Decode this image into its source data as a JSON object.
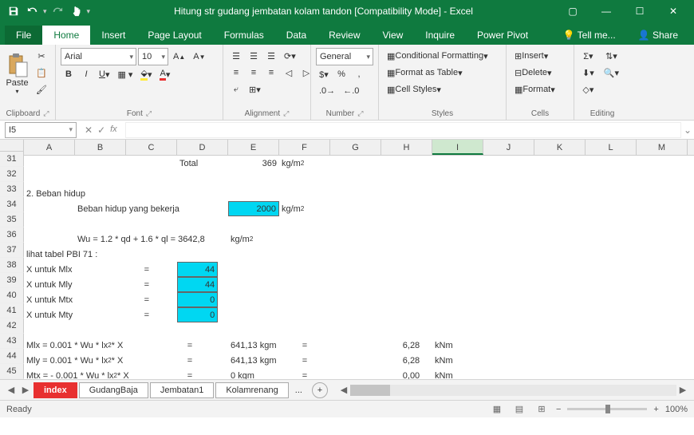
{
  "title": "Hitung str gudang jembatan kolam tandon  [Compatibility Mode] - Excel",
  "tabs": [
    "File",
    "Home",
    "Insert",
    "Page Layout",
    "Formulas",
    "Data",
    "Review",
    "View",
    "Inquire",
    "Power Pivot"
  ],
  "tellme": "Tell me...",
  "share": "Share",
  "ribbon": {
    "clipboard": "Clipboard",
    "paste": "Paste",
    "font": "Font",
    "fontname": "Arial",
    "fontsize": "10",
    "alignment": "Alignment",
    "number": "Number",
    "numfmt": "General",
    "styles": "Styles",
    "cf": "Conditional Formatting",
    "fat": "Format as Table",
    "cs": "Cell Styles",
    "cells": "Cells",
    "insert": "Insert",
    "delete": "Delete",
    "format": "Format",
    "editing": "Editing"
  },
  "namebox": "I5",
  "cols": [
    "A",
    "B",
    "C",
    "D",
    "E",
    "F",
    "G",
    "H",
    "I",
    "J",
    "K",
    "L",
    "M"
  ],
  "rows": [
    "31",
    "32",
    "33",
    "34",
    "35",
    "36",
    "37",
    "38",
    "39",
    "40",
    "41",
    "42",
    "43",
    "44",
    "45"
  ],
  "cells": {
    "d31": "Total",
    "e31": "369",
    "f31": "kg/m",
    "a33": "2. Beban hidup",
    "bcd34": "Beban hidup yang bekerja",
    "e34": "2000",
    "f34": "kg/m",
    "b36": "Wu = 1.2 * qd + 1.6 * ql   =    3642,8",
    "e36": "kg/m",
    "a37": "lihat tabel  PBI 71 :",
    "a38": "X untuk Mlx",
    "c38eq": "=",
    "d38": "44",
    "a39": "X untuk Mly",
    "d39": "44",
    "a40": "X untuk Mtx",
    "d40": "0",
    "a41": "X untuk Mty",
    "d41": "0",
    "a43": "Mlx = 0.001 * Wu * lx",
    "a43b": " * X",
    "d43": "=",
    "e43": "641,13",
    "e43u": "kgm",
    "f43": "=",
    "h43": "6,28",
    "i43": "kNm",
    "a44": "Mly = 0.001 * Wu * lx",
    "e44": "641,13",
    "h44": "6,28",
    "a45": "Mtx = - 0.001 * Wu * lx",
    "e45": "0",
    "e45u": "kgm",
    "h45": "0,00",
    "i45": "kNm"
  },
  "sheets": [
    "index",
    "GudangBaja",
    "Jembatan1",
    "Kolamrenang"
  ],
  "dots": "...",
  "status": "Ready",
  "zoom": "100%"
}
